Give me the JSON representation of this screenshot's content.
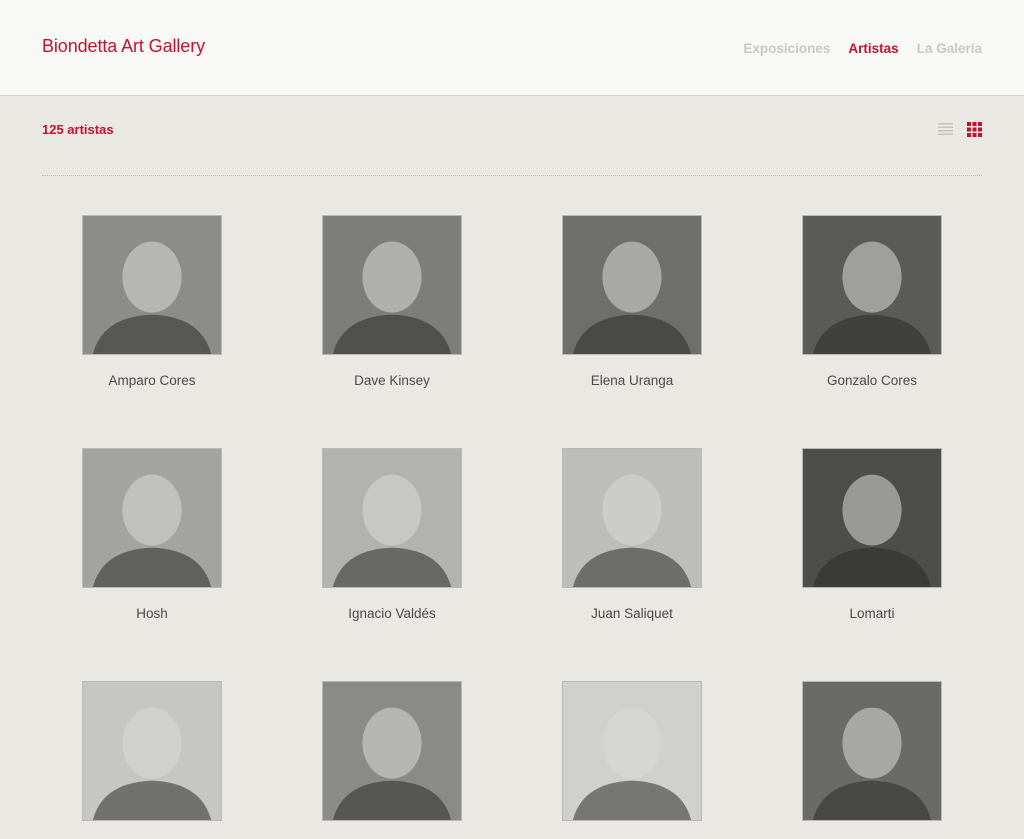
{
  "header": {
    "brand": "Biondetta Art Gallery",
    "nav": [
      {
        "label": "Exposiciones",
        "active": false
      },
      {
        "label": "Artistas",
        "active": true
      },
      {
        "label": "La Galería",
        "active": false
      }
    ],
    "accent_color": "#c8102e"
  },
  "toolbar": {
    "count_label": "125 artistas",
    "views": [
      {
        "icon": "list-view-icon",
        "active": false
      },
      {
        "icon": "grid-view-icon",
        "active": true
      }
    ]
  },
  "artists": [
    {
      "name": "Amparo Cores",
      "tone": "#8c8c8a",
      "photo": "grayscale portrait"
    },
    {
      "name": "Dave Kinsey",
      "tone": "#7d7d7b",
      "photo": "grayscale portrait"
    },
    {
      "name": "Elena Uranga",
      "tone": "#6e6e6c",
      "photo": "grayscale portrait"
    },
    {
      "name": "Gonzalo Cores",
      "tone": "#5a5a58",
      "photo": "grayscale portrait"
    },
    {
      "name": "Hosh",
      "tone": "#a3a3a1",
      "photo": "grayscale portrait"
    },
    {
      "name": "Ignacio Valdés",
      "tone": "#b2b2b0",
      "photo": "grayscale portrait"
    },
    {
      "name": "Juan Saliquet",
      "tone": "#bdbdbb",
      "photo": "grayscale portrait"
    },
    {
      "name": "Lomarti",
      "tone": "#4d4d4b",
      "photo": "grayscale portrait"
    },
    {
      "name": "",
      "tone": "#c6c6c4",
      "photo": "grayscale portrait"
    },
    {
      "name": "",
      "tone": "#8a8a88",
      "photo": "grayscale portrait"
    },
    {
      "name": "",
      "tone": "#d0d0ce",
      "photo": "grayscale portrait"
    },
    {
      "name": "",
      "tone": "#6a6a68",
      "photo": "grayscale portrait"
    }
  ]
}
